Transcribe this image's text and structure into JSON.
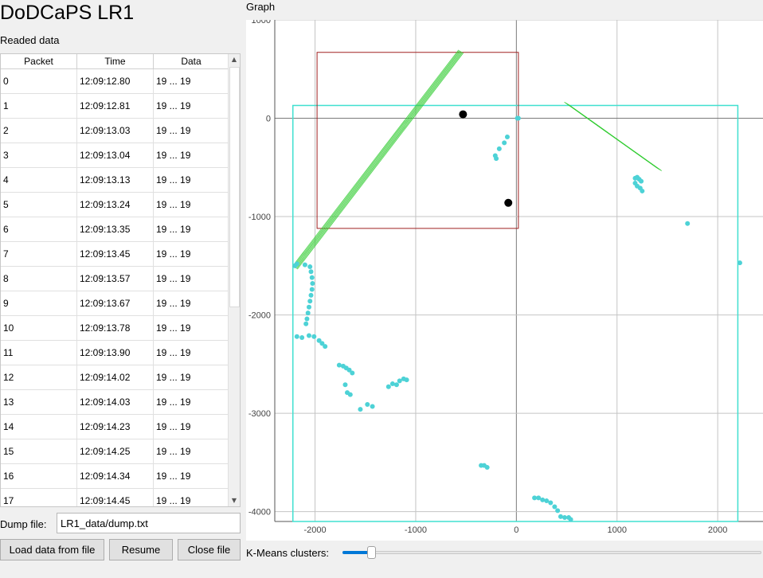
{
  "app": {
    "title": "DoDCaPS LR1"
  },
  "data_section": {
    "label": "Readed data"
  },
  "table": {
    "columns": [
      "Packet",
      "Time",
      "Data"
    ],
    "rows": [
      [
        "0",
        "12:09:12.80",
        "19 ... 19"
      ],
      [
        "1",
        "12:09:12.81",
        "19 ... 19"
      ],
      [
        "2",
        "12:09:13.03",
        "19 ... 19"
      ],
      [
        "3",
        "12:09:13.04",
        "19 ... 19"
      ],
      [
        "4",
        "12:09:13.13",
        "19 ... 19"
      ],
      [
        "5",
        "12:09:13.24",
        "19 ... 19"
      ],
      [
        "6",
        "12:09:13.35",
        "19 ... 19"
      ],
      [
        "7",
        "12:09:13.45",
        "19 ... 19"
      ],
      [
        "8",
        "12:09:13.57",
        "19 ... 19"
      ],
      [
        "9",
        "12:09:13.67",
        "19 ... 19"
      ],
      [
        "10",
        "12:09:13.78",
        "19 ... 19"
      ],
      [
        "11",
        "12:09:13.90",
        "19 ... 19"
      ],
      [
        "12",
        "12:09:14.02",
        "19 ... 19"
      ],
      [
        "13",
        "12:09:14.03",
        "19 ... 19"
      ],
      [
        "14",
        "12:09:14.23",
        "19 ... 19"
      ],
      [
        "15",
        "12:09:14.25",
        "19 ... 19"
      ],
      [
        "16",
        "12:09:14.34",
        "19 ... 19"
      ],
      [
        "17",
        "12:09:14.45",
        "19 ... 19"
      ]
    ]
  },
  "dump": {
    "label": "Dump file:",
    "value": "LR1_data/dump.txt"
  },
  "buttons": {
    "load": "Load data from file",
    "resume": "Resume",
    "close": "Close file"
  },
  "graph": {
    "label": "Graph"
  },
  "kmeans": {
    "label": "K-Means clusters:",
    "value_fraction": 0.06
  },
  "colors": {
    "points": "#4dd2d6",
    "cluster_box": "#40e0d0",
    "roi_box": "#a02020",
    "line_fit": "#33cc33",
    "centroid": "#000000"
  },
  "chart_data": {
    "type": "scatter",
    "xlim": [
      -2400,
      2450
    ],
    "ylim": [
      -4100,
      1000
    ],
    "x_ticks": [
      -2000,
      -1000,
      0,
      1000,
      2000
    ],
    "y_ticks": [
      1000,
      0,
      -1000,
      -2000,
      -3000,
      -4000
    ],
    "x_tick_labels": [
      "-2000",
      "-1000",
      "0",
      "1000",
      "2000"
    ],
    "y_tick_labels": [
      "1000",
      "0",
      "-1000",
      "-2000",
      "-3000",
      "-4000"
    ],
    "grid": true,
    "points": [
      [
        -2200,
        -1500
      ],
      [
        -2180,
        -1480
      ],
      [
        -2100,
        -1490
      ],
      [
        -2050,
        -1510
      ],
      [
        -2040,
        -1560
      ],
      [
        -2030,
        -1620
      ],
      [
        -2025,
        -1680
      ],
      [
        -2030,
        -1740
      ],
      [
        -2040,
        -1800
      ],
      [
        -2050,
        -1860
      ],
      [
        -2060,
        -1920
      ],
      [
        -2070,
        -1980
      ],
      [
        -2080,
        -2040
      ],
      [
        -2090,
        -2090
      ],
      [
        -2180,
        -2220
      ],
      [
        -2130,
        -2230
      ],
      [
        -2060,
        -2210
      ],
      [
        -2010,
        -2220
      ],
      [
        -1960,
        -2260
      ],
      [
        -1930,
        -2290
      ],
      [
        -1900,
        -2320
      ],
      [
        -1760,
        -2510
      ],
      [
        -1720,
        -2520
      ],
      [
        -1690,
        -2540
      ],
      [
        -1660,
        -2560
      ],
      [
        -1630,
        -2590
      ],
      [
        -1700,
        -2710
      ],
      [
        -1680,
        -2790
      ],
      [
        -1650,
        -2810
      ],
      [
        -1550,
        -2960
      ],
      [
        -1480,
        -2910
      ],
      [
        -1430,
        -2930
      ],
      [
        -1270,
        -2730
      ],
      [
        -1230,
        -2700
      ],
      [
        -1190,
        -2710
      ],
      [
        -1160,
        -2670
      ],
      [
        -1120,
        -2650
      ],
      [
        -1090,
        -2660
      ],
      [
        -350,
        -3530
      ],
      [
        -320,
        -3530
      ],
      [
        -290,
        -3550
      ],
      [
        180,
        -3860
      ],
      [
        220,
        -3860
      ],
      [
        260,
        -3880
      ],
      [
        300,
        -3890
      ],
      [
        340,
        -3910
      ],
      [
        380,
        -3950
      ],
      [
        410,
        -3990
      ],
      [
        440,
        -4050
      ],
      [
        480,
        -4060
      ],
      [
        520,
        -4060
      ],
      [
        540,
        -4080
      ],
      [
        -210,
        -380
      ],
      [
        -200,
        -410
      ],
      [
        -170,
        -310
      ],
      [
        -120,
        -250
      ],
      [
        -90,
        -190
      ],
      [
        10,
        0
      ],
      [
        20,
        0
      ],
      [
        1180,
        -610
      ],
      [
        1200,
        -600
      ],
      [
        1220,
        -620
      ],
      [
        1240,
        -640
      ],
      [
        1180,
        -660
      ],
      [
        1200,
        -690
      ],
      [
        1230,
        -710
      ],
      [
        1250,
        -740
      ],
      [
        1700,
        -1070
      ],
      [
        2220,
        -1470
      ]
    ],
    "centroids": [
      [
        -530,
        40
      ],
      [
        -80,
        -860
      ]
    ],
    "roi_box": {
      "x": [
        -1980,
        20
      ],
      "y": [
        -1120,
        670
      ]
    },
    "cluster_box": {
      "x": [
        -2220,
        2200
      ],
      "y": [
        -4100,
        130
      ]
    },
    "line_segments": [
      {
        "x": [
          -2200,
          -550
        ],
        "y": [
          -1520,
          680
        ]
      },
      {
        "x": [
          500,
          1420
        ],
        "y": [
          150,
          -520
        ]
      }
    ]
  }
}
